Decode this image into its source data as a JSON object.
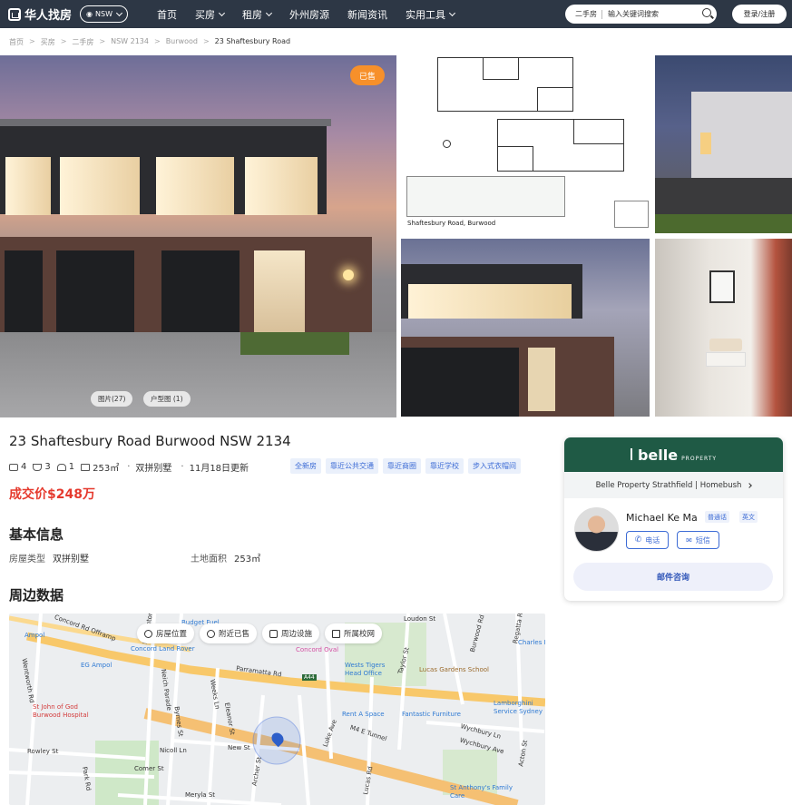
{
  "header": {
    "logo_text": "华人找房",
    "region": "NSW",
    "nav": [
      {
        "label": "首页",
        "dropdown": false
      },
      {
        "label": "买房",
        "dropdown": true
      },
      {
        "label": "租房",
        "dropdown": true
      },
      {
        "label": "外州房源",
        "dropdown": false
      },
      {
        "label": "新闻资讯",
        "dropdown": false
      },
      {
        "label": "实用工具",
        "dropdown": true
      }
    ],
    "search_type": "二手房",
    "search_placeholder": "输入关键词搜索",
    "login_label": "登录/注册"
  },
  "breadcrumb": [
    "首页",
    "买房",
    "二手房",
    "NSW 2134",
    "Burwood",
    "23 Shaftesbury Road"
  ],
  "gallery": {
    "sold_badge": "已售",
    "photos_label": "图片(27)",
    "floorplan_label": "户型图 (1)",
    "floorplan_address": "Shaftesbury Road, Burwood"
  },
  "listing": {
    "title": "23 Shaftesbury Road Burwood NSW 2134",
    "beds": "4",
    "baths": "3",
    "cars": "1",
    "land": "253㎡",
    "property_type": "双拼别墅",
    "updated": "11月18日更新",
    "tags": [
      "全新房",
      "靠近公共交通",
      "靠近商圈",
      "靠近学校",
      "步入式衣帽间"
    ],
    "price": "成交价$248万"
  },
  "basic_info": {
    "heading": "基本信息",
    "type_label": "房屋类型",
    "type_value": "双拼别墅",
    "land_label": "土地面积",
    "land_value": "253㎡"
  },
  "surroundings": {
    "heading": "周边数据",
    "toolbar": [
      "房屋位置",
      "附近已售",
      "周边设施",
      "所属校网"
    ],
    "places": [
      {
        "name": "Ampol",
        "color": "#2f7ad3"
      },
      {
        "name": "Concord Land Rover",
        "color": "#2f7ad3"
      },
      {
        "name": "EG Ampol",
        "color": "#2f7ad3"
      },
      {
        "name": "Concord Oval",
        "color": "#d34fa2"
      },
      {
        "name": "Wests Tigers Head Office",
        "color": "#2f7ad3"
      },
      {
        "name": "Lucas Gardens School",
        "color": "#9a6a2b"
      },
      {
        "name": "Charles Fu",
        "color": "#2f7ad3"
      },
      {
        "name": "St John of God Burwood Hospital",
        "color": "#d33c3c"
      },
      {
        "name": "Rent A Space",
        "color": "#2f7ad3"
      },
      {
        "name": "Fantastic Furniture",
        "color": "#2f7ad3"
      },
      {
        "name": "Lamborghini Service Sydney",
        "color": "#2f7ad3"
      },
      {
        "name": "St Anthony's Family Care",
        "color": "#2f7ad3"
      },
      {
        "name": "Budget Fuel",
        "color": "#2f7ad3"
      }
    ],
    "roads": [
      "Concord Rd Offramp",
      "Parramatta Rd",
      "A44",
      "M4 E Tunnel",
      "Wentworth Rd",
      "Neich Parade",
      "Weeks Ln",
      "Rowley St",
      "Comer St",
      "Park Rd",
      "Meryla St",
      "Nicoll Ln",
      "Byrnes St",
      "Eleanor St",
      "New St",
      "Archer St",
      "Luke Ave",
      "Lucas Rd",
      "Wychbury Ln",
      "Wychbury Ave",
      "Taylor St",
      "Acton St",
      "Burwood Rd",
      "Regatta Rd",
      "Loudon St",
      "Broughton Rd"
    ]
  },
  "agent": {
    "agency_logo": "belle",
    "agency_logo_sub": "PROPERTY",
    "agency_name": "Belle Property Strathfield | Homebush",
    "name": "Michael Ke Ma",
    "languages": [
      "普通话",
      "英文"
    ],
    "call_label": "电话",
    "sms_label": "短信",
    "email_label": "邮件咨询"
  }
}
